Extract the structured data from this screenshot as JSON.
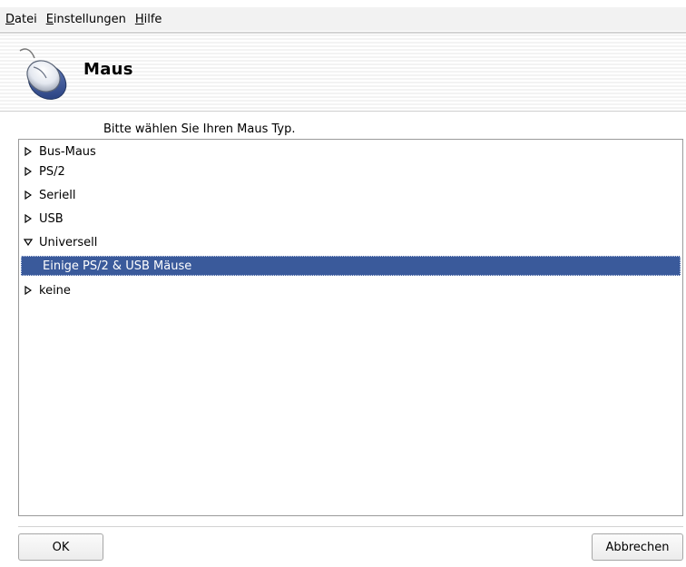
{
  "menubar": {
    "items": [
      {
        "accel": "D",
        "rest": "atei"
      },
      {
        "accel": "E",
        "rest": "instellungen"
      },
      {
        "accel": "H",
        "rest": "ilfe"
      }
    ]
  },
  "header": {
    "title": "Maus",
    "icon": "mouse-icon"
  },
  "prompt": "Bitte wählen Sie Ihren Maus Typ.",
  "tree": {
    "items": [
      {
        "label": "Bus-Maus",
        "expanded": false
      },
      {
        "label": "PS/2",
        "expanded": false
      },
      {
        "label": "Seriell",
        "expanded": false
      },
      {
        "label": "USB",
        "expanded": false
      },
      {
        "label": "Universell",
        "expanded": true
      },
      {
        "label": "Einige PS/2 & USB Mäuse",
        "child": true,
        "selected": true
      },
      {
        "label": "keine",
        "expanded": false
      }
    ]
  },
  "buttons": {
    "ok": "OK",
    "cancel": "Abbrechen"
  },
  "colors": {
    "selection": "#3a5a9b"
  }
}
